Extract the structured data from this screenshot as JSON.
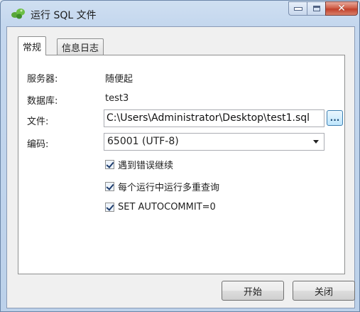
{
  "window": {
    "title": "运行 SQL 文件",
    "controls": {
      "minimize_icon": "minimize-icon",
      "maximize_icon": "maximize-icon",
      "close_icon": "close-icon",
      "close_glyph": "✕"
    }
  },
  "tabs": [
    {
      "label": "常规",
      "active": true
    },
    {
      "label": "信息日志",
      "active": false
    }
  ],
  "general": {
    "server_label": "服务器:",
    "server_value": "随便起",
    "database_label": "数据库:",
    "database_value": "test3",
    "file_label": "文件:",
    "file_value": "C:\\Users\\Administrator\\Desktop\\test1.sql",
    "browse_label": "...",
    "encoding_label": "编码:",
    "encoding_value": "65001 (UTF-8)",
    "options": [
      {
        "label": "遇到错误继续",
        "checked": true
      },
      {
        "label": "每个运行中运行多重查询",
        "checked": true
      },
      {
        "label": "SET AUTOCOMMIT=0",
        "checked": true
      }
    ]
  },
  "footer": {
    "start_label": "开始",
    "close_label": "关闭"
  },
  "colors": {
    "accent": "#3c7fb1",
    "close_button": "#c1412c",
    "title_bar": "#c4d7ee"
  }
}
